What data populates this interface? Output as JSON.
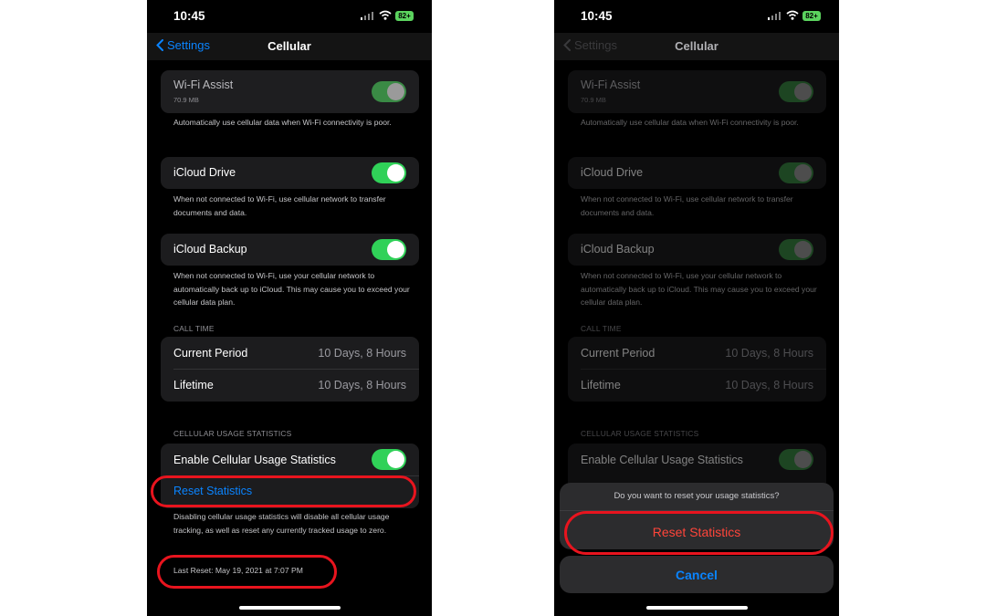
{
  "status": {
    "time": "10:45",
    "battery": "82+"
  },
  "nav": {
    "back_label": "Settings",
    "title": "Cellular"
  },
  "wifi_assist": {
    "label": "Wi-Fi Assist",
    "sub": "70.9 MB",
    "on": true,
    "desc": "Automatically use cellular data when Wi-Fi connectivity is poor."
  },
  "icloud_drive": {
    "label": "iCloud Drive",
    "on": true,
    "desc": "When not connected to Wi-Fi, use cellular network to transfer documents and data."
  },
  "icloud_backup": {
    "label": "iCloud Backup",
    "on": true,
    "desc": "When not connected to Wi-Fi, use your cellular network to automatically back up to iCloud. This may cause you to exceed your cellular data plan."
  },
  "call_time": {
    "header": "CALL TIME",
    "rows": [
      {
        "label": "Current Period",
        "value": "10 Days, 8 Hours"
      },
      {
        "label": "Lifetime",
        "value": "10 Days, 8 Hours"
      }
    ]
  },
  "usage": {
    "header": "CELLULAR USAGE STATISTICS",
    "enable_label": "Enable Cellular Usage Statistics",
    "enable_on": true,
    "reset_label": "Reset Statistics",
    "desc": "Disabling cellular usage statistics will disable all cellular usage tracking, as well as reset any currently tracked usage to zero.",
    "last_reset": "Last Reset: May 19, 2021 at 7:07 PM"
  },
  "sheet": {
    "message": "Do you want to reset your usage statistics?",
    "confirm_label": "Reset Statistics",
    "cancel_label": "Cancel"
  },
  "colors": {
    "accent": "#0a84ff",
    "toggle_on": "#30d158",
    "destructive": "#ff453a",
    "highlight_ring": "#e8141e"
  }
}
